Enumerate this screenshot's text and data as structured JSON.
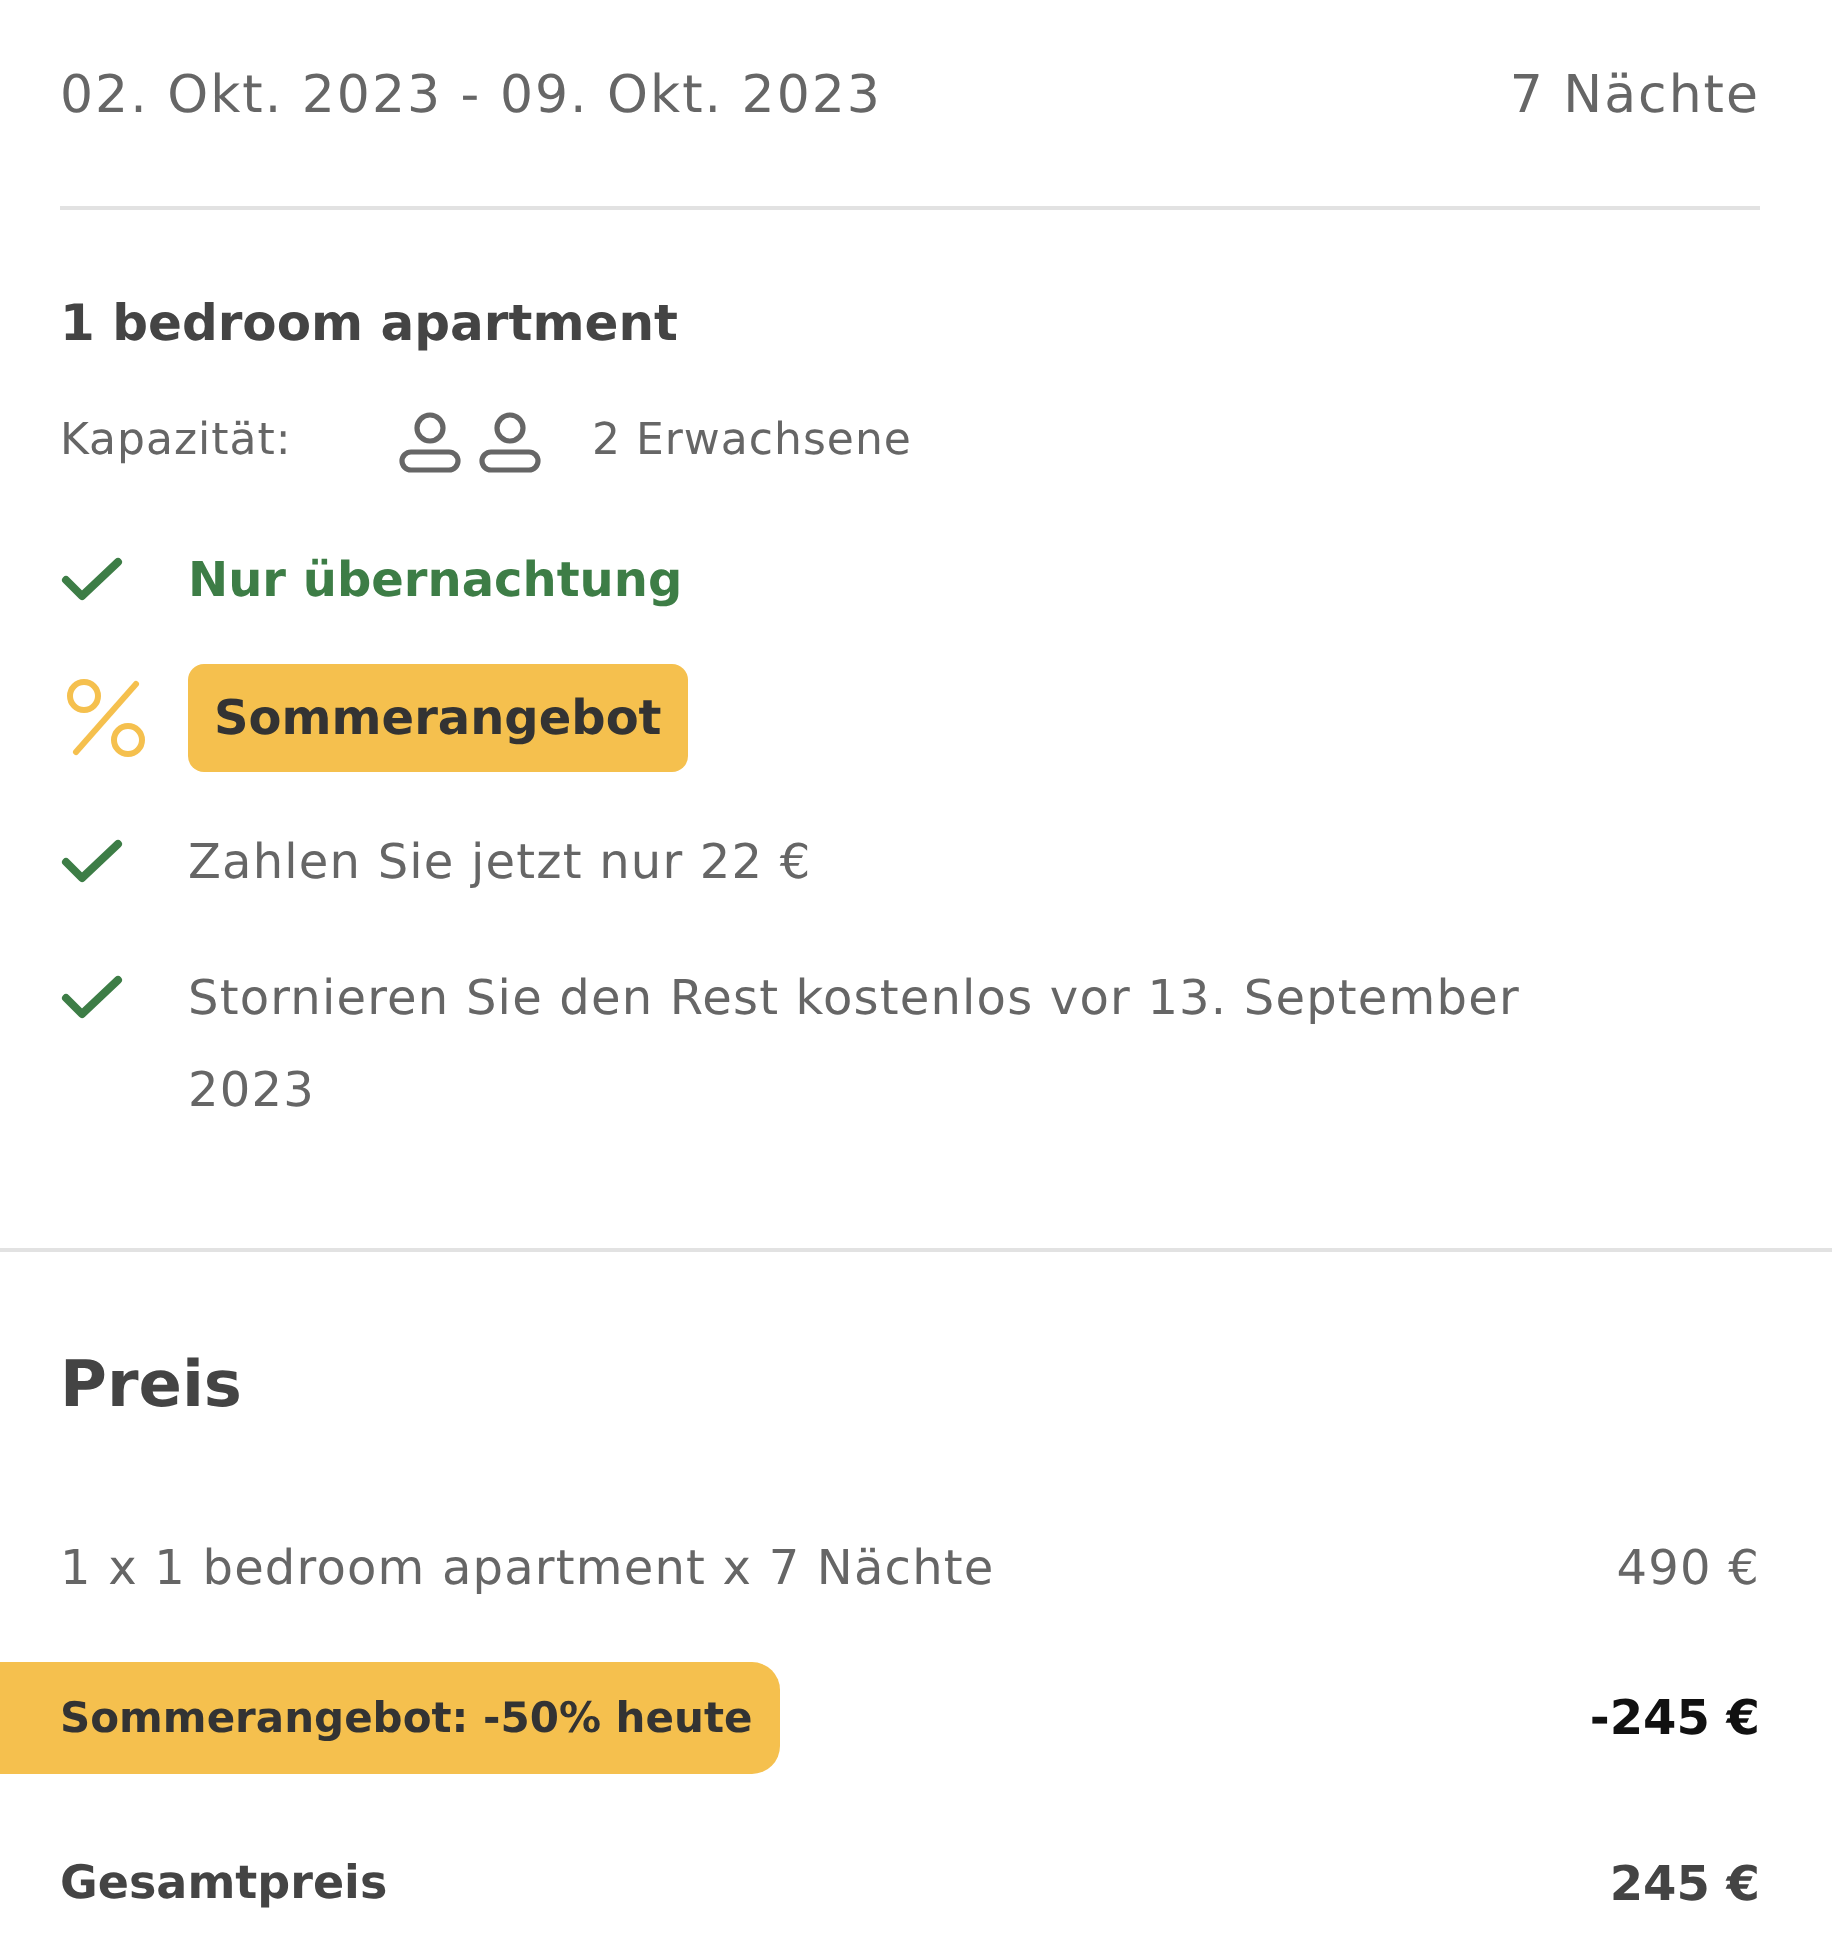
{
  "stay": {
    "dates": "02. Okt. 2023 - 09. Okt. 2023",
    "nights": "7 Nächte"
  },
  "room": {
    "name": "1 bedroom apartment",
    "capacity_label": "Kapazität:",
    "guests": "2 Erwachsene"
  },
  "features": [
    {
      "kind": "board",
      "label": "Nur übernachtung"
    },
    {
      "kind": "offer",
      "label": "Sommerangebot"
    },
    {
      "kind": "condition",
      "label": "Zahlen Sie jetzt nur 22 €"
    },
    {
      "kind": "condition",
      "label": "Stornieren Sie den Rest kostenlos vor 13. September 2023"
    }
  ],
  "price": {
    "title": "Preis",
    "lines": [
      {
        "kind": "item",
        "label": "1 x 1 bedroom apartment x 7 Nächte",
        "amount": "490 €"
      },
      {
        "kind": "discount",
        "label": "Sommerangebot: -50% heute",
        "amount": "-245 €"
      },
      {
        "kind": "total",
        "label": "Gesamtpreis",
        "amount": "245 €"
      }
    ]
  }
}
